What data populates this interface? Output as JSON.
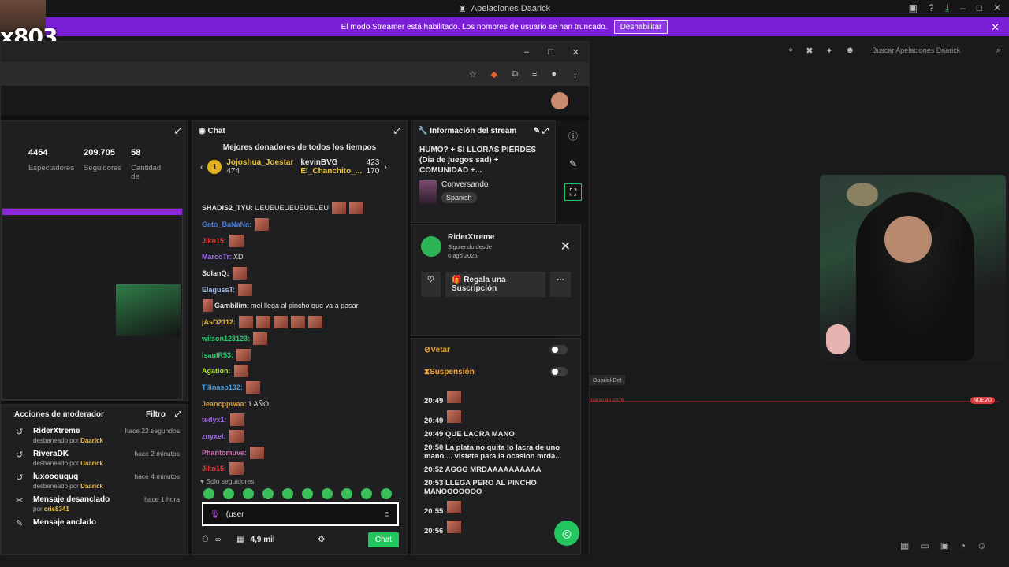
{
  "app": {
    "title": "Apelaciones Daarick",
    "handle": "x803"
  },
  "banner": {
    "text": "El modo Streamer está habilitado. Los nombres de usuario se han truncado.",
    "button": "Deshabilitar"
  },
  "stats": [
    {
      "value": "4454",
      "label": "Espectadores"
    },
    {
      "value": "209.705",
      "label": "Seguidores"
    },
    {
      "value": "58",
      "label": "Cantidad de suscripciones"
    }
  ],
  "mod": {
    "title": "Acciones de moderador",
    "filter": "Filtro",
    "items": [
      {
        "name": "RiderXtreme",
        "sub": "desbaneado por",
        "by": "Daarick",
        "time": "hace 22 segundos"
      },
      {
        "name": "RiveraDK",
        "sub": "desbaneado por",
        "by": "Daarick",
        "time": "hace 2 minutos"
      },
      {
        "name": "luxooququq",
        "sub": "desbaneado por",
        "by": "Daarick",
        "time": "hace 4 minutos"
      },
      {
        "name": "Mensaje desanclado",
        "sub": "por",
        "by": "cris8341",
        "time": "hace 1 hora"
      },
      {
        "name": "Mensaje anclado",
        "sub": "",
        "by": "",
        "time": ""
      }
    ]
  },
  "chat": {
    "title": "Chat",
    "donors_title": "Mejores donadores de todos los tiempos",
    "donors": [
      {
        "rank": "1",
        "name": "Jojoshua_Joestar",
        "amount": "474"
      },
      {
        "rank": "",
        "name": "kevinBVG",
        "amount": "423"
      },
      {
        "rank": "",
        "name": "El_Chanchito_...",
        "amount": "170"
      }
    ],
    "messages": [
      {
        "user": "SHADIS2_TYU:",
        "text": "UEUEUEUEUEUEUEU",
        "color": "#d9d9d9"
      },
      {
        "user": "Gato_BaNaNa:",
        "text": "",
        "color": "#4a7bd8"
      },
      {
        "user": "Jiko15:",
        "text": "",
        "color": "#e23a3a"
      },
      {
        "user": "MarcoTr:",
        "text": "XD",
        "color": "#a26be8"
      },
      {
        "user": "SolanQ:",
        "text": "",
        "color": "#e9e9e9"
      },
      {
        "user": "ElagussT:",
        "text": "",
        "color": "#9bb8e6"
      },
      {
        "user": "Gambilim:",
        "text": "mel llega al pincho que va a pasar",
        "color": "#e9e9e9"
      },
      {
        "user": "jAsD2112:",
        "text": "",
        "color": "#e0b83a"
      },
      {
        "user": "wilson123123:",
        "text": "",
        "color": "#2ecc71"
      },
      {
        "user": "IsauIR53:",
        "text": "",
        "color": "#2ecc71"
      },
      {
        "user": "Agation:",
        "text": "",
        "color": "#a6e22e"
      },
      {
        "user": "Tilinaso132:",
        "text": "",
        "color": "#4a9ee0"
      },
      {
        "user": "Jeancppwaa:",
        "text": "1 AÑO",
        "color": "#d19b3a"
      },
      {
        "user": "tedyx1:",
        "text": "",
        "color": "#a26be8"
      },
      {
        "user": "znyxel:",
        "text": "",
        "color": "#a26be8"
      },
      {
        "user": "Phantomuve:",
        "text": "",
        "color": "#d66bb5"
      },
      {
        "user": "Jiko15:",
        "text": "",
        "color": "#e23a3a"
      }
    ],
    "followers_only": "Solo seguidores",
    "input_value": "(user",
    "bits": "∞",
    "points": "4,9 mil",
    "send": "Chat"
  },
  "info": {
    "title": "Información del stream",
    "stream_title": "HUMO? + SI LLORAS PIERDES (Dia de juegos sad) + COMUNIDAD +...",
    "category": "Conversando",
    "language": "Spanish"
  },
  "usercard": {
    "name": "RiderXtreme",
    "following": "Siguiendo desde",
    "date": "6 ago 2025",
    "gift": "Regala una Suscripción",
    "ban": "Vetar",
    "timeout": "Suspensión",
    "log": [
      {
        "t": "20:49",
        "m": ""
      },
      {
        "t": "20:49",
        "m": ""
      },
      {
        "t": "20:49",
        "m": "QUE LACRA MANO"
      },
      {
        "t": "20:50",
        "m": "La plata no quita lo lacra de uno mano.... vistete para la ocasion mrda..."
      },
      {
        "t": "20:52",
        "m": "AGGG MRDAAAAAAAAAA"
      },
      {
        "t": "20:53",
        "m": "LLEGA PERO AL PINCHO MANOOOOOOO"
      },
      {
        "t": "20:55",
        "m": ""
      },
      {
        "t": "20:56",
        "m": ""
      }
    ]
  },
  "right": {
    "search_placeholder": "Buscar Apelaciones Daarick",
    "cam_label": "DaarickBet",
    "nuevo": "NUEVO",
    "date": "marzo de 2026"
  }
}
